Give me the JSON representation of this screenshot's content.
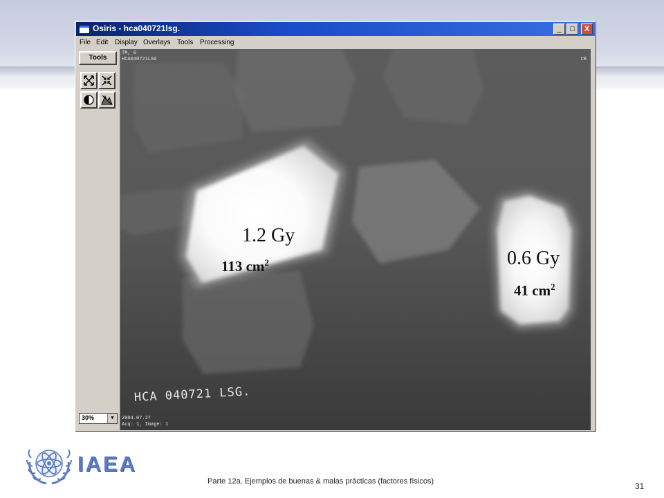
{
  "window": {
    "title": "Osiris - hca040721lsg.",
    "menu": [
      "File",
      "Edit",
      "Display",
      "Overlays",
      "Tools",
      "Processing"
    ],
    "controls": {
      "minimize": "_",
      "maximize": "□",
      "close": "X"
    }
  },
  "tools_panel": {
    "tools_label": "Tools",
    "zoom_value": "30%"
  },
  "image_viewer": {
    "top_left_line1": "TM, 0",
    "top_left_line2": "HCA040721LSG",
    "top_right": "CR",
    "bottom_left_line1": "2004.07.27",
    "bottom_left_line2": "Acq: 1, Image: 1",
    "handwriting": "HCA 040721 LSG."
  },
  "annotations": {
    "left_field": {
      "dose": "1.2 Gy",
      "area_value": "113 cm",
      "area_sup": "2"
    },
    "right_field": {
      "dose": "0.6 Gy",
      "area_value": "41 cm",
      "area_sup": "2"
    }
  },
  "slide": {
    "logo_text": "IAEA",
    "footer": "Parte 12a. Ejemplos de buenas & malas prácticas (factores físicos)",
    "page_number": "31"
  },
  "colors": {
    "titlebar": "#0a246a",
    "window_face": "#d4d0c8",
    "logo": "#5b7cc0"
  },
  "icons": [
    "app-icon",
    "zoom-fit-icon",
    "zoom-in-icon",
    "contrast-icon",
    "histogram-icon",
    "atom-logo-icon"
  ]
}
